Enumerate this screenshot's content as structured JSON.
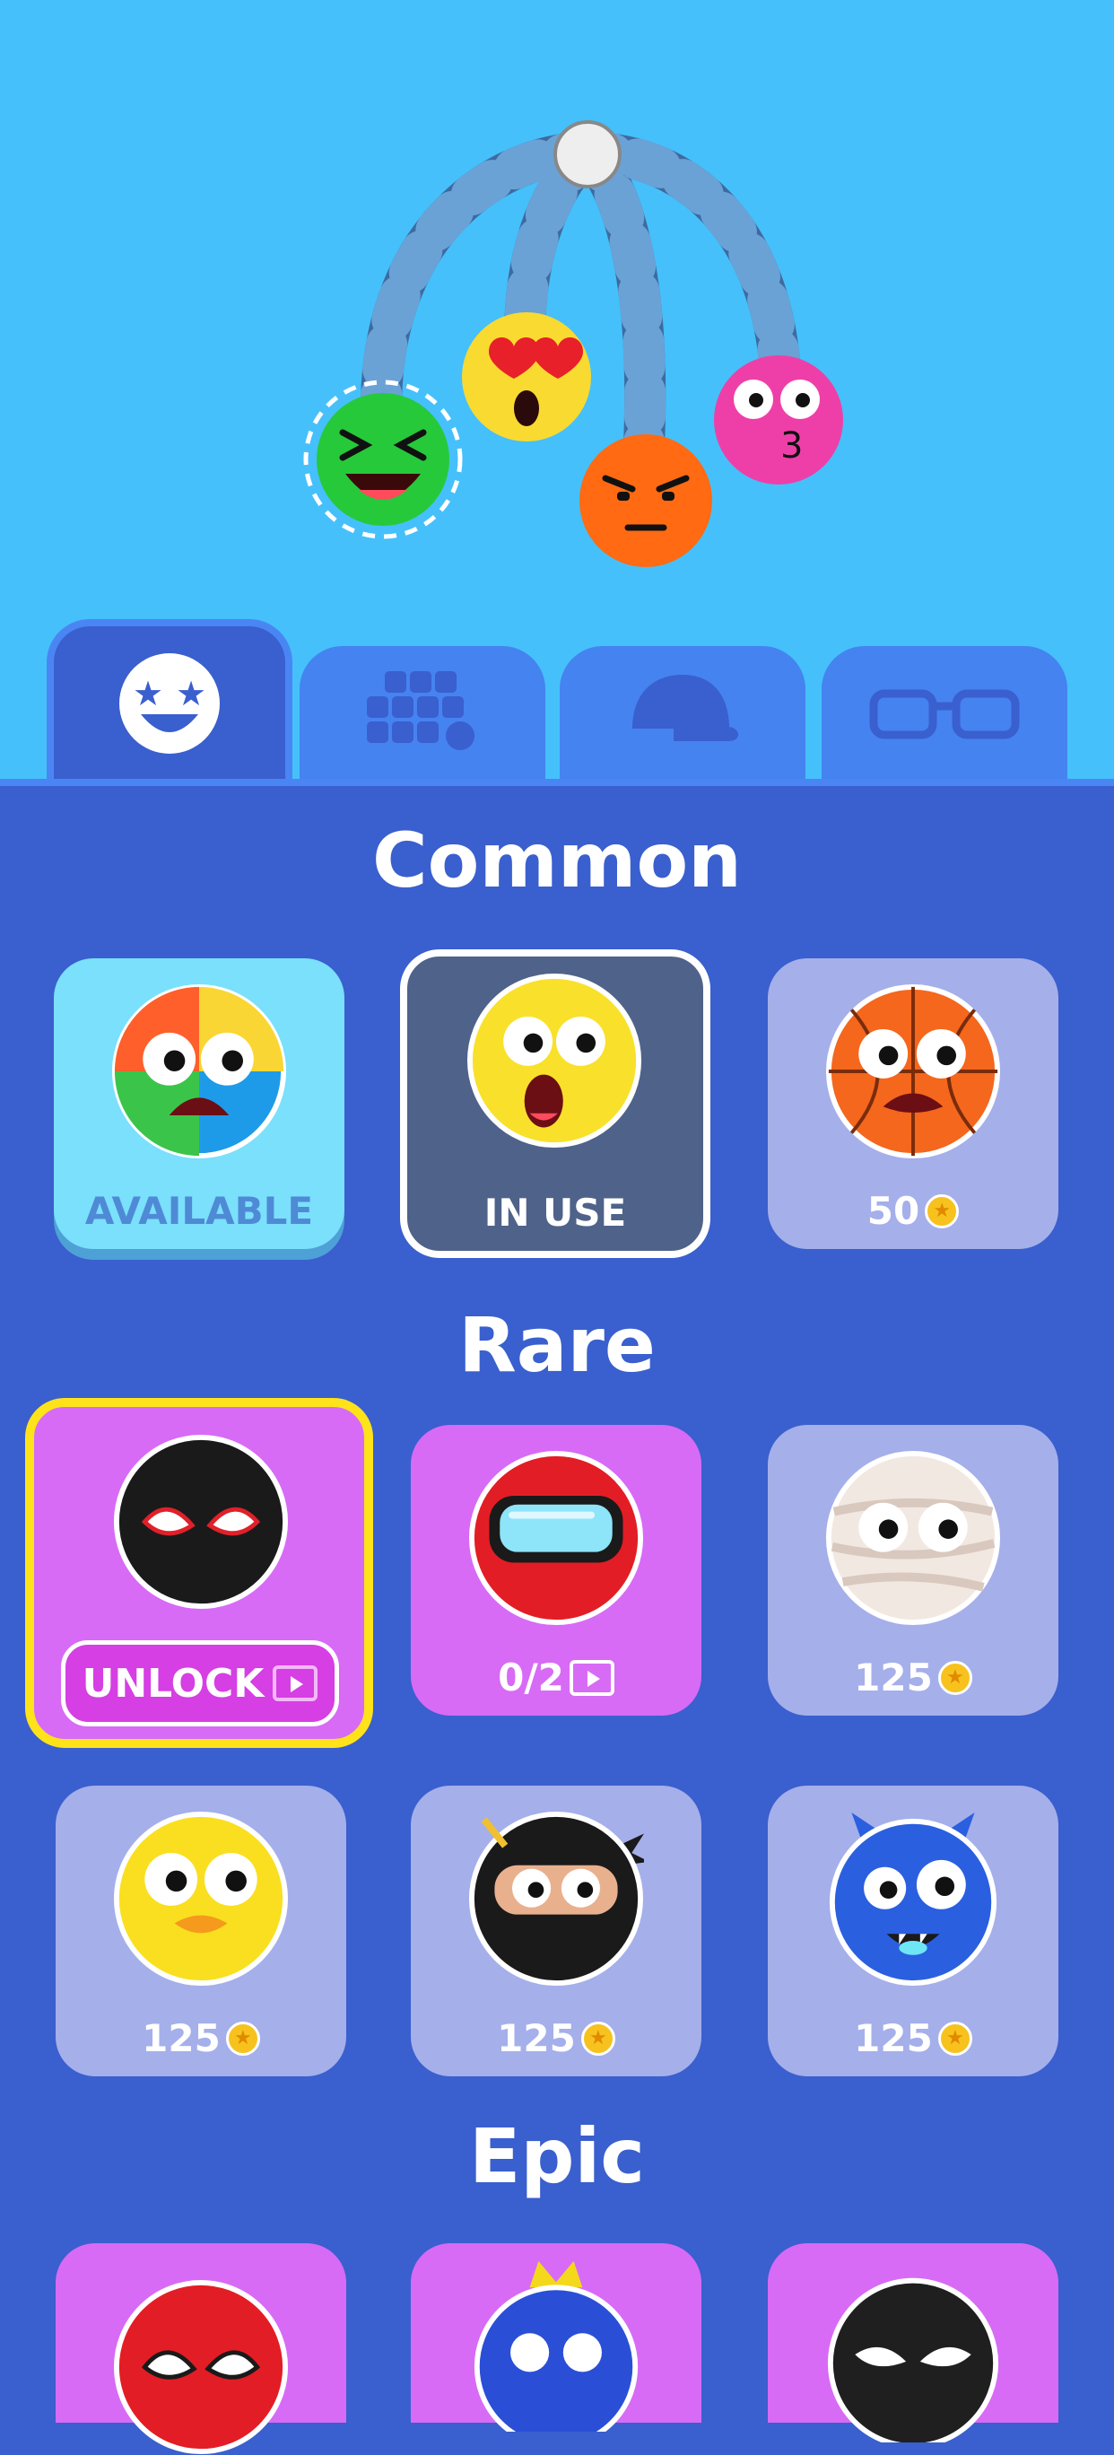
{
  "tabs": [
    {
      "icon": "star-eyes-face-icon"
    },
    {
      "icon": "pattern-grid-icon"
    },
    {
      "icon": "cap-icon"
    },
    {
      "icon": "glasses-icon"
    }
  ],
  "sections": {
    "common": {
      "title": "Common"
    },
    "rare": {
      "title": "Rare"
    },
    "epic": {
      "title": "Epic"
    }
  },
  "common_items": [
    {
      "label": "AVAILABLE",
      "state": "available",
      "icon": "beach-ball-face-icon"
    },
    {
      "label": "IN USE",
      "state": "in-use",
      "icon": "shocked-yellow-face-icon"
    },
    {
      "label": "50",
      "state": "price",
      "icon": "basketball-face-icon"
    }
  ],
  "rare_items": [
    {
      "label": "UNLOCK",
      "state": "unlock",
      "icon": "spider-mask-face-icon"
    },
    {
      "label": "0/2",
      "state": "video",
      "icon": "goggles-face-icon"
    },
    {
      "label": "125",
      "state": "price",
      "icon": "mummy-face-icon"
    },
    {
      "label": "125",
      "state": "price",
      "icon": "duck-face-icon"
    },
    {
      "label": "125",
      "state": "price",
      "icon": "ninja-face-icon"
    },
    {
      "label": "125",
      "state": "price",
      "icon": "blue-monster-face-icon"
    }
  ],
  "epic_items": [
    {
      "icon": "red-spider-mask-face-icon"
    },
    {
      "icon": "blue-king-face-icon"
    },
    {
      "icon": "venom-face-icon"
    }
  ],
  "colors": {
    "sky": "#45c0fb",
    "panel": "#3a5fce",
    "tab": "#4583f0",
    "card_locked": "#a5afea",
    "card_rare": "#d76bf5",
    "card_available": "#7ae0fb",
    "card_in_use": "#4f628a",
    "highlight": "#ffe31a",
    "unlock_button": "#d53fe3"
  }
}
